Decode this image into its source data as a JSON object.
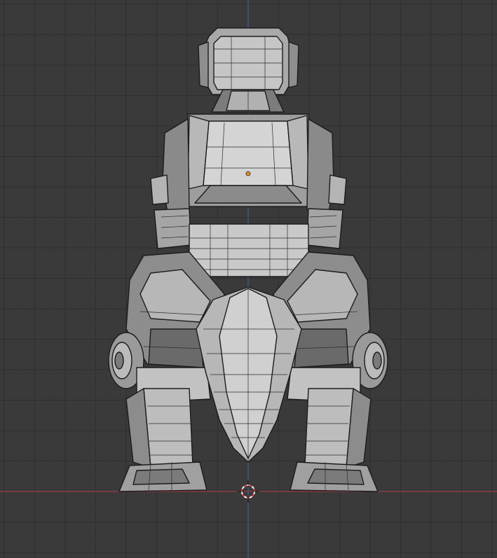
{
  "viewport": {
    "background_color": "#3a3a3a",
    "grid_minor_color": "#363636",
    "grid_major_color": "#2f2f2f",
    "x_axis_color": "#9a3a45",
    "z_axis_color": "#3d5f9a",
    "mesh_fill_light": "#bdbdbd",
    "mesh_fill_mid": "#9b9b9b",
    "mesh_fill_dark": "#6e6e6e",
    "mesh_edge_color": "#1c1c1c",
    "origin_color": "#f0901a",
    "cursor_color_a": "#e23b3b",
    "cursor_color_b": "#ffffff"
  },
  "objects": [
    {
      "name": "robot-mesh",
      "icon": "mesh-object"
    }
  ],
  "gizmos": [
    {
      "name": "object-origin",
      "icon": "origin-dot"
    },
    {
      "name": "3d-cursor",
      "icon": "crosshair-cursor"
    }
  ]
}
